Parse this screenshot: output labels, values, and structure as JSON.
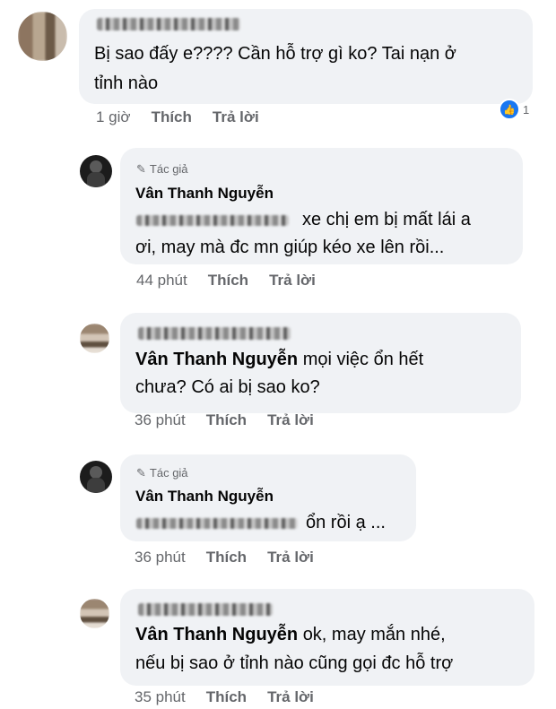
{
  "comments": [
    {
      "text_lines": [
        "Bị sao đấy e???? Cần hỗ trợ gì ko? Tai nạn ở",
        "tỉnh nào"
      ],
      "time": "1 giờ",
      "like_label": "Thích",
      "reply_label": "Trả lời",
      "reaction_count": "1"
    },
    {
      "author_tag": "Tác giả",
      "author": "Vân Thanh Nguyễn",
      "text_lines": [
        "xe chị em bị mất lái a",
        "ơi, may mà đc mn giúp kéo xe lên rồi..."
      ],
      "time": "44 phút",
      "like_label": "Thích",
      "reply_label": "Trả lời"
    },
    {
      "mention": "Vân Thanh Nguyễn",
      "text_lines": [
        "mọi việc ổn hết",
        "chưa? Có ai bị sao ko?"
      ],
      "time": "36 phút",
      "like_label": "Thích",
      "reply_label": "Trả lời"
    },
    {
      "author_tag": "Tác giả",
      "author": "Vân Thanh Nguyễn",
      "text_lines": [
        "ổn rồi ạ ..."
      ],
      "time": "36 phút",
      "like_label": "Thích",
      "reply_label": "Trả lời"
    },
    {
      "mention": "Vân Thanh Nguyễn",
      "text_lines": [
        "ok, may mắn nhé,",
        "nếu bị sao ở tỉnh nào cũng gọi đc hỗ trợ"
      ],
      "time": "35 phút",
      "like_label": "Thích",
      "reply_label": "Trả lời"
    }
  ],
  "icons": {
    "author_pen": "pen-icon",
    "like": "like-icon"
  },
  "colors": {
    "bubble": "#f0f2f5",
    "meta": "#65676b",
    "like_blue": "#1877f2"
  }
}
